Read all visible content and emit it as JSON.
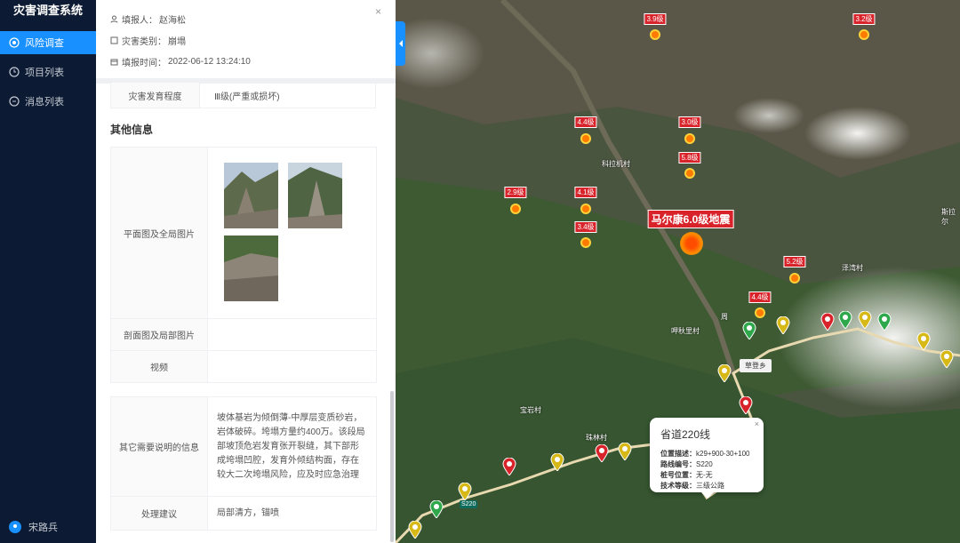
{
  "app": {
    "title": "灾害调查系统"
  },
  "sidebar": {
    "items": [
      {
        "label": "风险调查",
        "active": true
      },
      {
        "label": "项目列表"
      },
      {
        "label": "消息列表"
      }
    ],
    "user": "宋路兵"
  },
  "panel": {
    "reporter_label": "填报人：",
    "reporter": "赵海松",
    "type_label": "灾害类别：",
    "type": "崩塌",
    "time_label": "填报时间：",
    "time": "2022-06-12 13:24:10",
    "develop_label": "灾害发育程度",
    "develop": "Ⅲ级(严重或损坏)",
    "section_other": "其他信息",
    "plan_label": "平面图及全局图片",
    "profile_label": "剖面图及局部图片",
    "video_label": "视频",
    "note_label": "其它需要说明的信息",
    "note": "坡体基岩为倾倒薄-中厚层变质砂岩，岩体破碎。垮塌方量约400万。该段局部坡顶危岩发育张开裂缝，其下部形成垮塌凹腔，发育外倾结构面，存在较大二次垮塌风险，应及时应急治理",
    "advice_label": "处理建议",
    "advice": "局部清方，锚喷"
  },
  "map": {
    "places": [
      "科拉机村",
      "泽湾村",
      "呷秋里村",
      "宝岩村",
      "珠林村",
      "斯拉尔",
      "周"
    ],
    "magnitudes": [
      "3.9级",
      "3.2级",
      "4.4级",
      "3.0级",
      "5.8级",
      "2.9级",
      "4.1级",
      "3.4级",
      "5.2级",
      "4.4级"
    ],
    "main_quake": "马尔康6.0级地震",
    "town": "草登乡",
    "road_tag": "S220",
    "popup": {
      "title": "省道220线",
      "location_label": "位置描述：",
      "location": "k29+900-30+100",
      "road_code_label": "路线编号：",
      "road_code": "S220",
      "stake_label": "桩号位置：",
      "stake": "无-无",
      "grade_label": "技术等级：",
      "grade": "三级公路"
    }
  },
  "colors": {
    "accent": "#1890ff",
    "sidebar_bg": "#0c1b33",
    "quake_tag": "#d9232a"
  }
}
